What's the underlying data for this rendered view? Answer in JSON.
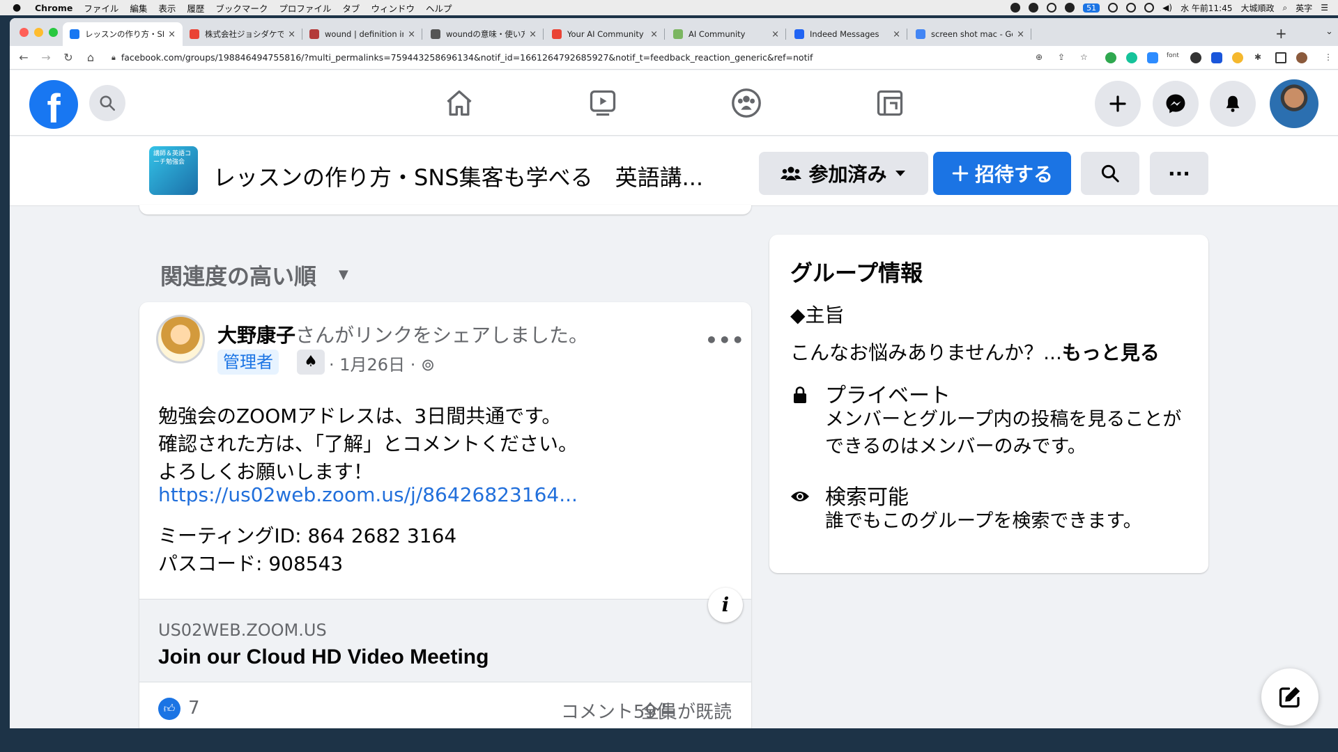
{
  "menubar": {
    "app": "Chrome",
    "items": [
      "ファイル",
      "編集",
      "表示",
      "履歴",
      "ブックマーク",
      "プロファイル",
      "タブ",
      "ウィンドウ",
      "ヘルプ"
    ],
    "badge": "51",
    "clock": "水 午前11:45",
    "user": "大城順政",
    "input_mode": "英字"
  },
  "browser": {
    "tabs": [
      {
        "label": "レッスンの作り方・SNS集客",
        "color": "#1877f2"
      },
      {
        "label": "株式会社ジョシダケで多彩な",
        "color": "#ea4335"
      },
      {
        "label": "wound | definition in the Le",
        "color": "#b33a3a"
      },
      {
        "label": "woundの意味・使い方・読み",
        "color": "#555555"
      },
      {
        "label": "Your AI Community passw",
        "color": "#ea4335"
      },
      {
        "label": "AI Community",
        "color": "#7bb661"
      },
      {
        "label": "Indeed Messages",
        "color": "#2164f3"
      },
      {
        "label": "screen shot mac - Google",
        "color": "#4285f4"
      }
    ],
    "url": "facebook.com/groups/198846494755816/?multi_permalinks=759443258696134&notif_id=1661264792685927&notif_t=feedback_reaction_generic&ref=notif",
    "ext_font_label": "font"
  },
  "group": {
    "thumb_text": "講師＆英語コーチ勉強会",
    "title": "レッスンの作り方・SNS集客も学べる　英語講...",
    "joined_label": "参加済み",
    "invite_label": "招待する"
  },
  "sort": {
    "label": "関連度の高い順"
  },
  "post": {
    "author": "大野康子",
    "action": "さんがリンクをシェアしました。",
    "role": "管理者",
    "meta": "· 1月26日 ·",
    "lines": [
      "勉強会のZOOMアドレスは、3日間共通です。",
      "確認された方は、「了解」とコメントください。",
      "よろしくお願いします！"
    ],
    "link": "https://us02web.zoom.us/j/86426823164...",
    "meeting_id": "ミーティングID: 864 2682 3164",
    "passcode": "パスコード: 908543",
    "preview_domain": "US02WEB.ZOOM.US",
    "preview_title": "Join our Cloud HD Video Meeting",
    "likes": "7",
    "comments": "コメント59件",
    "seen": "全員が既読"
  },
  "info": {
    "title": "グループ情報",
    "purpose": "◆主旨",
    "desc": "こんなお悩みありませんか？...",
    "more": "もっと見る",
    "private_title": "プライベート",
    "private_desc": "メンバーとグループ内の投稿を見ることができるのはメンバーのみです。",
    "search_title": "検索可能",
    "search_desc": "誰でもこのグループを検索できます。"
  },
  "colors": {
    "fb_blue": "#1877f2",
    "invite_blue": "#1b74e4",
    "link": "#216fdb",
    "bg": "#f0f2f5"
  }
}
